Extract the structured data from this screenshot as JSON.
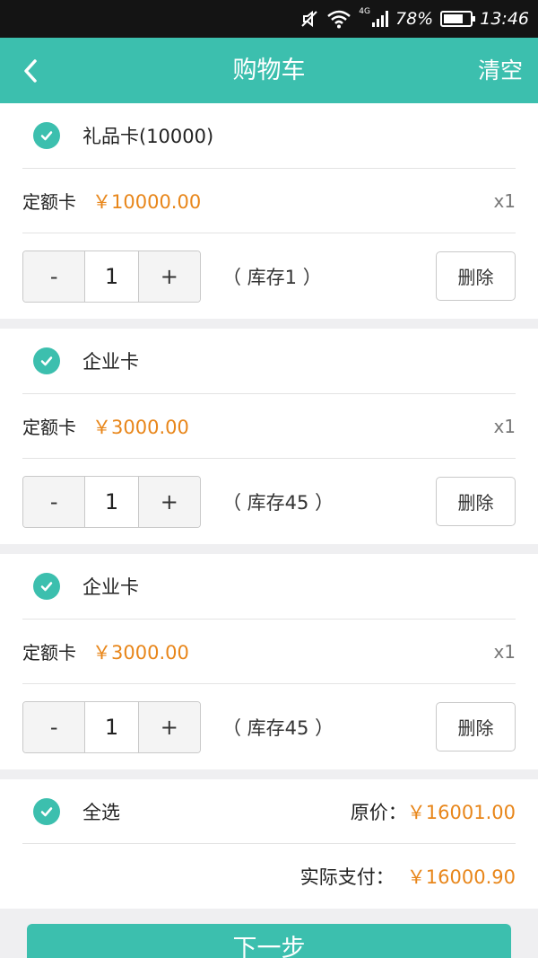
{
  "status_bar": {
    "network": "4G",
    "battery": "78%",
    "time": "13:46",
    "battery_level": 0.78
  },
  "nav": {
    "title": "购物车",
    "clear_label": "清空"
  },
  "items": [
    {
      "name": "礼品卡(10000)",
      "card_type": "定额卡",
      "price": "￥10000.00",
      "count": "x1",
      "qty": "1",
      "stock": "（ 库存1 ）",
      "minus": "-",
      "plus": "+",
      "delete_label": "删除",
      "checked": true
    },
    {
      "name": "企业卡",
      "card_type": "定额卡",
      "price": "￥3000.00",
      "count": "x1",
      "qty": "1",
      "stock": "（ 库存45 ）",
      "minus": "-",
      "plus": "+",
      "delete_label": "删除",
      "checked": true
    },
    {
      "name": "企业卡",
      "card_type": "定额卡",
      "price": "￥3000.00",
      "count": "x1",
      "qty": "1",
      "stock": "（ 库存45 ）",
      "minus": "-",
      "plus": "+",
      "delete_label": "删除",
      "checked": true
    }
  ],
  "summary": {
    "select_all_label": "全选",
    "original_label": "原价：",
    "original_price": "￥16001.00",
    "actual_label": "实际支付：",
    "actual_price": "￥16000.90"
  },
  "next_label": "下一步",
  "colors": {
    "accent": "#3cbfae",
    "price": "#e8861a",
    "status_bar": "#141414",
    "background": "#efeff1"
  }
}
